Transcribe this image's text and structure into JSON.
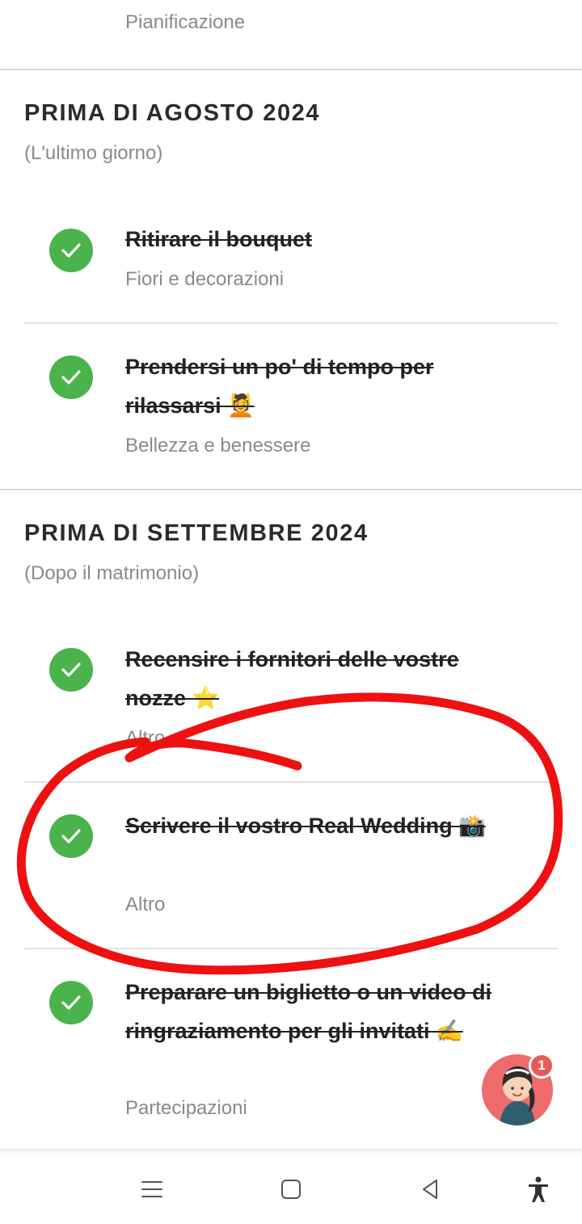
{
  "top_item": {
    "category": "Pianificazione"
  },
  "sections": [
    {
      "title": "PRIMA DI AGOSTO 2024",
      "subtitle": "(L'ultimo giorno)",
      "tasks": [
        {
          "title": "Ritirare il bouquet",
          "category": "Fiori e decorazioni",
          "done": true
        },
        {
          "title": "Prendersi un po' di tempo per rilassarsi 💆",
          "category": "Bellezza e benessere",
          "done": true
        }
      ]
    },
    {
      "title": "PRIMA DI SETTEMBRE 2024",
      "subtitle": "(Dopo il matrimonio)",
      "tasks": [
        {
          "title": "Recensire i fornitori delle vostre nozze ⭐",
          "category": "Altro",
          "done": true
        },
        {
          "title": "Scrivere il vostro Real Wedding 📸",
          "category": "Altro",
          "done": true
        },
        {
          "title": "Preparare un biglietto o un video di ringraziamento per gli invitati ✍️",
          "category": "Partecipazioni",
          "done": true
        }
      ]
    }
  ],
  "chat_badge": {
    "count": "1"
  },
  "icons": {
    "check": "check-icon",
    "menu": "menu-icon",
    "home": "home-icon",
    "back": "back-icon",
    "accessibility": "accessibility-icon"
  },
  "colors": {
    "check_green": "#4bb34b",
    "badge_red": "#e85a5a",
    "annotation_red": "#ee1111",
    "muted_text": "#8a8a8a"
  }
}
